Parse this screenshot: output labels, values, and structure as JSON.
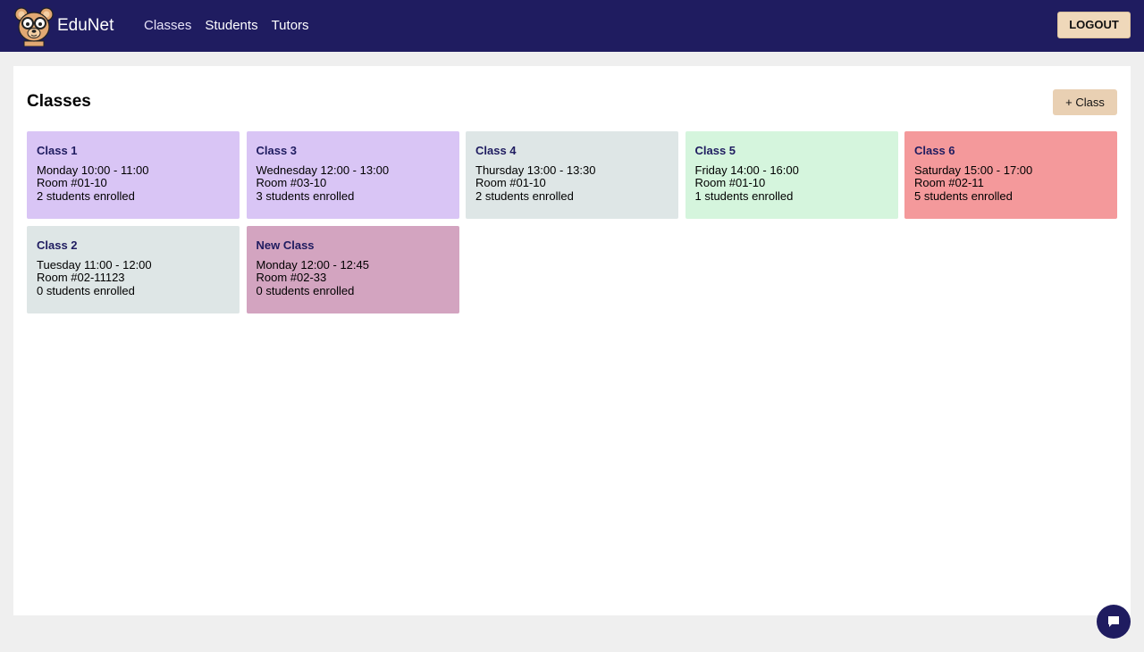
{
  "brand": {
    "name": "EduNet"
  },
  "nav": {
    "items": [
      {
        "label": "Classes"
      },
      {
        "label": "Students"
      },
      {
        "label": "Tutors"
      }
    ]
  },
  "header": {
    "logout_label": "LOGOUT"
  },
  "main": {
    "title": "Classes",
    "add_button_label": "+ Class",
    "classes": [
      {
        "name": "Class 1",
        "schedule": "Monday 10:00 - 11:00",
        "room": "Room #01-10",
        "enrolled": "2 students enrolled",
        "color": "#d9c5f5"
      },
      {
        "name": "Class 3",
        "schedule": "Wednesday 12:00 - 13:00",
        "room": "Room #03-10",
        "enrolled": "3 students enrolled",
        "color": "#d9c5f5"
      },
      {
        "name": "Class 4",
        "schedule": "Thursday 13:00 - 13:30",
        "room": "Room #01-10",
        "enrolled": "2 students enrolled",
        "color": "#dee6e6"
      },
      {
        "name": "Class 5",
        "schedule": "Friday 14:00 - 16:00",
        "room": "Room #01-10",
        "enrolled": "1 students enrolled",
        "color": "#d5f5dd"
      },
      {
        "name": "Class 6",
        "schedule": "Saturday 15:00 - 17:00",
        "room": "Room #02-11",
        "enrolled": "5 students enrolled",
        "color": "#f4999b"
      },
      {
        "name": "Class 2",
        "schedule": "Tuesday 11:00 - 12:00",
        "room": "Room #02-11123",
        "enrolled": "0 students enrolled",
        "color": "#dee6e6"
      },
      {
        "name": "New Class",
        "schedule": "Monday 12:00 - 12:45",
        "room": "Room #02-33",
        "enrolled": "0 students enrolled",
        "color": "#d3a4c0"
      }
    ]
  },
  "chat": {
    "icon": "chat-bubble-icon"
  },
  "colors": {
    "topbar": "#1f1c60",
    "accent_button": "#efd8ba",
    "page_background": "#efefef"
  }
}
